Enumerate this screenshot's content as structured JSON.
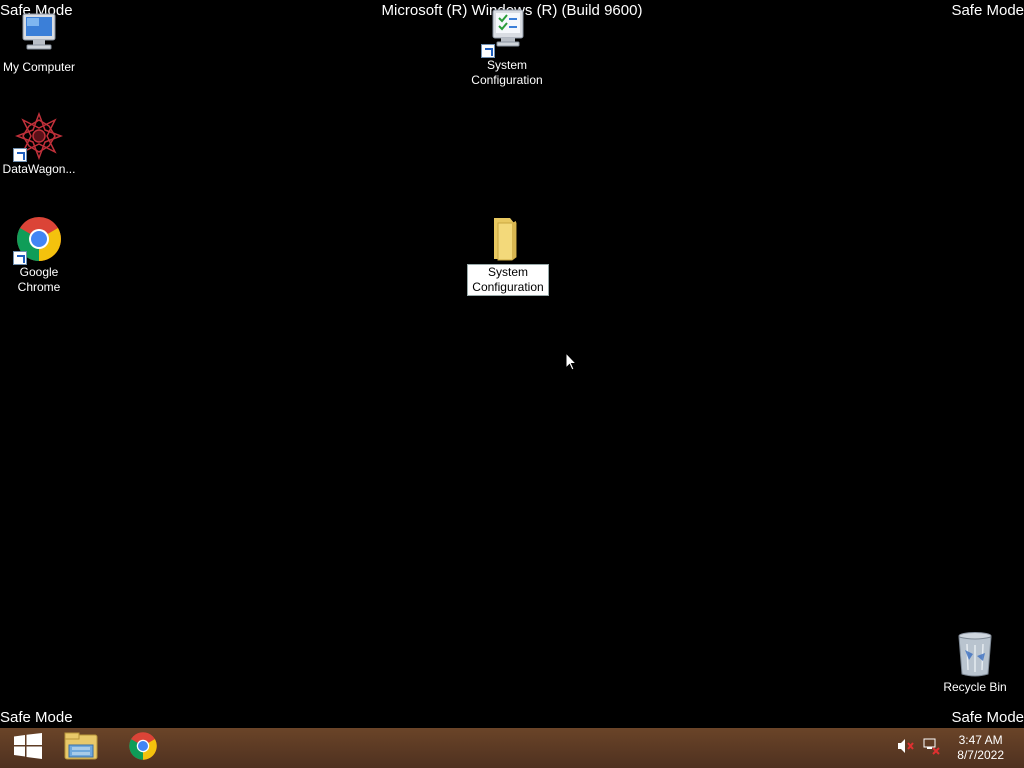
{
  "watermarks": {
    "top_left": "Safe Mode",
    "top_right": "Safe Mode",
    "bottom_left": "Safe Mode",
    "bottom_right": "Safe Mode",
    "title": "Microsoft (R) Windows (R) (Build 9600)"
  },
  "desktop_icons": {
    "my_computer": {
      "label": "My Computer",
      "icon": "computer-icon"
    },
    "datawagon": {
      "label": "DataWagon...",
      "icon": "datawagon-icon"
    },
    "google_chrome": {
      "label": "Google Chrome",
      "line1": "Google",
      "line2": "Chrome",
      "icon": "chrome-icon"
    },
    "system_config_shortcut": {
      "line1": "System",
      "line2": "Configuration",
      "icon": "msconfig-icon"
    },
    "system_config_folder": {
      "line1": "System",
      "line2": "Configuration",
      "icon": "folder-icon",
      "selected": true
    },
    "recycle_bin": {
      "label": "Recycle Bin",
      "icon": "recycle-bin-icon"
    }
  },
  "taskbar": {
    "start": {
      "icon": "windows-logo-icon"
    },
    "pinned": [
      {
        "name": "File Explorer",
        "icon": "file-explorer-icon"
      },
      {
        "name": "Google Chrome",
        "icon": "chrome-icon"
      }
    ],
    "tray": {
      "volume_icon": "volume-muted-icon",
      "network_icon": "network-disconnected-icon",
      "time": "3:47 AM",
      "date": "8/7/2022"
    }
  },
  "colors": {
    "desktop": "#000000",
    "taskbar": "#5a3a22"
  }
}
